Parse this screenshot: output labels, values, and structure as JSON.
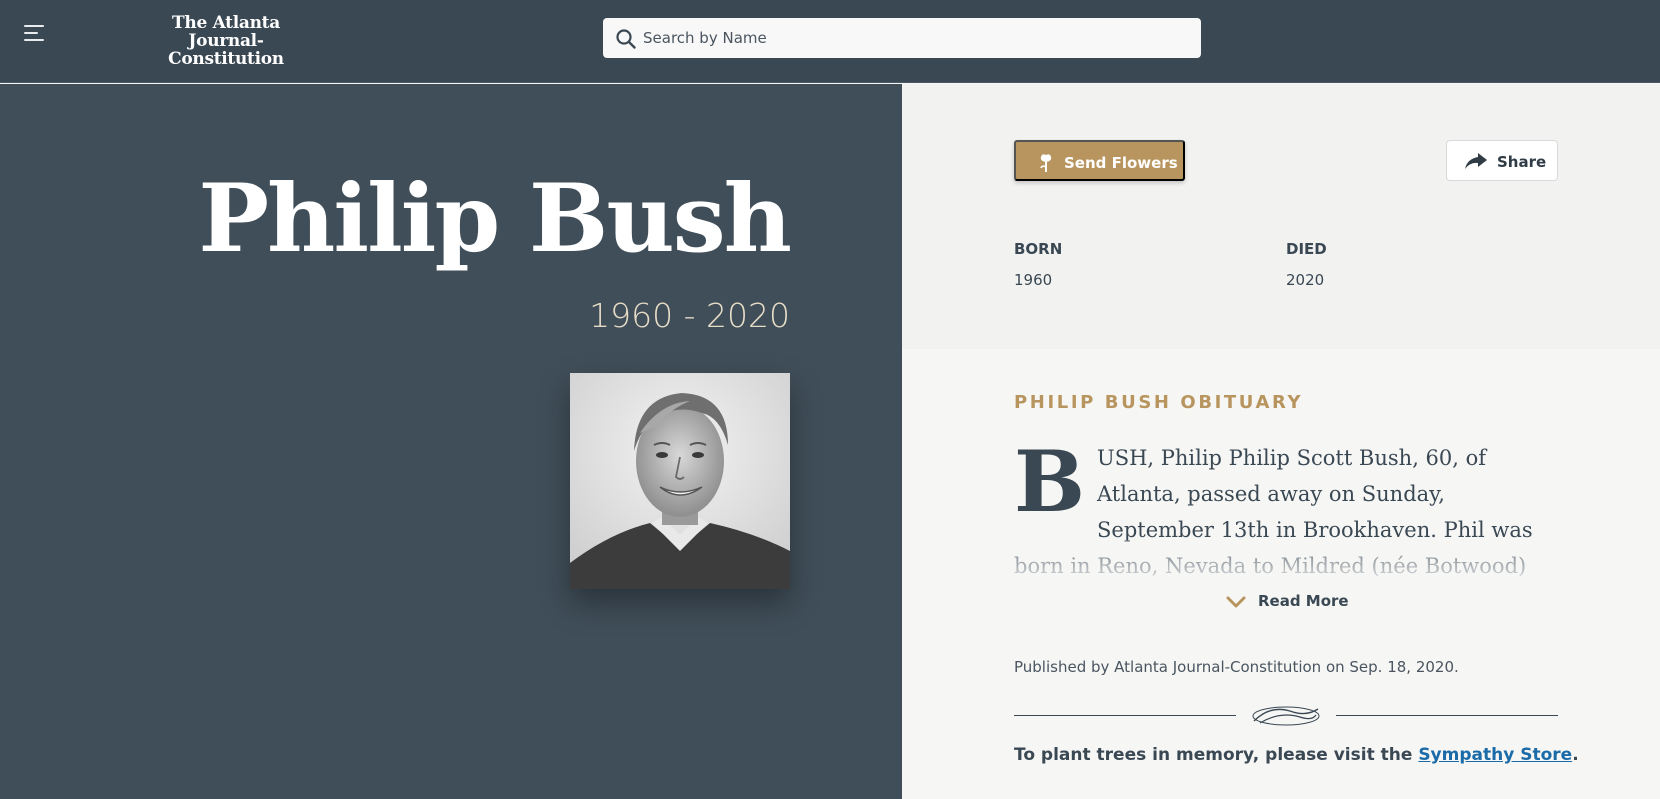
{
  "header": {
    "logo_line1": "The Atlanta",
    "logo_line2": "Journal-Constitution",
    "search_placeholder": "Search by Name"
  },
  "hero": {
    "name": "Philip Bush",
    "years": "1960 - 2020"
  },
  "actions": {
    "send_flowers": "Send Flowers",
    "share": "Share"
  },
  "dates": {
    "born_label": "BORN",
    "born_value": "1960",
    "died_label": "DIED",
    "died_value": "2020"
  },
  "obituary": {
    "heading": "PHILIP BUSH OBITUARY",
    "dropcap": "B",
    "text": "USH, Philip Philip Scott Bush, 60, of Atlanta, passed away on Sunday, September 13th in Brookhaven. Phil was born in Reno, Nevada to Mildred (née Botwood) and Ralph Howe Bush on",
    "read_more": "Read More",
    "published": "Published by Atlanta Journal-Constitution on Sep. 18, 2020."
  },
  "footer": {
    "trees_prefix": "To plant trees in memory, please visit the ",
    "sympathy_link": "Sympathy Store",
    "trees_suffix": "."
  },
  "colors": {
    "header_bg": "#3a4853",
    "hero_bg": "#404e59",
    "accent_gold": "#b8955f",
    "link_blue": "#1a6ba8"
  },
  "icons": [
    "menu-icon",
    "search-icon",
    "flower-icon",
    "share-arrow-icon",
    "chevron-down-icon",
    "flourish-ornament-icon"
  ]
}
